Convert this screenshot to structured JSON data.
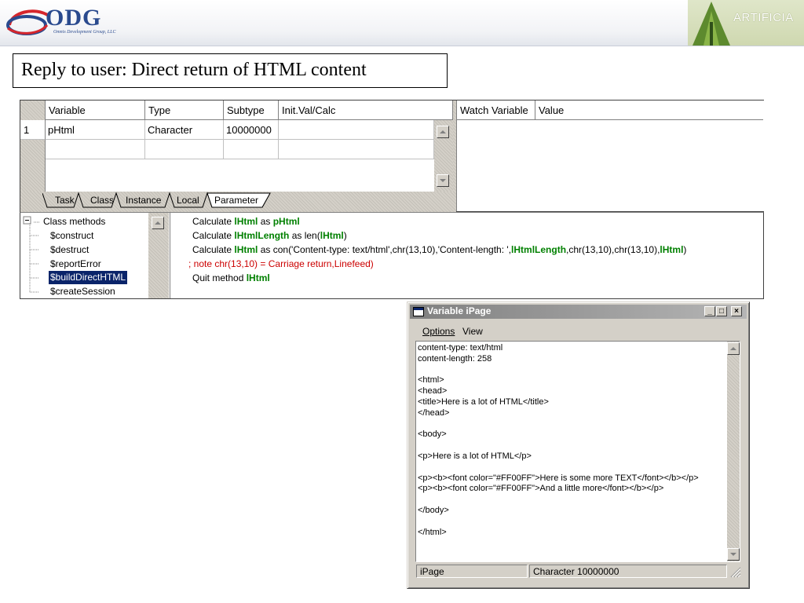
{
  "header": {
    "logo_text": "ODG",
    "logo_subtext": "Omnis Development Group, LLC",
    "right_logo_text": "ARTIFICIA",
    "colors": {
      "logo_blue": "#2a4a8e",
      "logo_red": "#d6262c",
      "artificia_green": "#5d8a2e"
    }
  },
  "slide_title": "Reply to user: Direct return of HTML content",
  "variables_grid": {
    "columns": [
      "Variable",
      "Type",
      "Subtype",
      "Init.Val/Calc"
    ],
    "rows": [
      {
        "num": "1",
        "variable": "pHtml",
        "type": "Character",
        "subtype": "10000000",
        "init": ""
      }
    ],
    "tabs": [
      "Task",
      "Class",
      "Instance",
      "Local",
      "Parameter"
    ],
    "active_tab": "Parameter",
    "watch_columns": [
      "Watch Variable",
      "Value"
    ]
  },
  "method_tree": {
    "root": "Class methods",
    "root_expander": "⊟",
    "items": [
      "$construct",
      "$destruct",
      "$reportError",
      "$buildDirectHTML",
      "$createSession"
    ],
    "selected": "$buildDirectHTML"
  },
  "code_lines": [
    [
      {
        "t": "Calculate ",
        "c": "kw"
      },
      {
        "t": "lHtml",
        "c": "var"
      },
      {
        "t": " as ",
        "c": "kw"
      },
      {
        "t": "pHtml",
        "c": "var"
      }
    ],
    [
      {
        "t": "Calculate ",
        "c": "kw"
      },
      {
        "t": "lHtmlLength",
        "c": "var"
      },
      {
        "t": " as len(",
        "c": "kw"
      },
      {
        "t": "lHtml",
        "c": "var"
      },
      {
        "t": ")",
        "c": "kw"
      }
    ],
    [
      {
        "t": "Calculate ",
        "c": "kw"
      },
      {
        "t": "lHtml",
        "c": "var"
      },
      {
        "t": " as con('Content-type: text/html',chr(13,10),'Content-length: ',",
        "c": "str"
      },
      {
        "t": "lHtmlLength",
        "c": "var"
      },
      {
        "t": ",chr(13,10),chr(13,10),",
        "c": "str"
      },
      {
        "t": "lHtml",
        "c": "var"
      },
      {
        "t": ")",
        "c": "str"
      }
    ],
    [
      {
        "t": ";  note chr(13,10) = Carriage return,Linefeed)",
        "c": "cmt"
      }
    ],
    [
      {
        "t": "Quit method ",
        "c": "kw"
      },
      {
        "t": "lHtml",
        "c": "var"
      }
    ]
  ],
  "ipage_window": {
    "title": "Variable iPage",
    "menu": [
      "Options",
      "View"
    ],
    "content_lines": [
      "content-type: text/html",
      "content-length: 258",
      "",
      "<html>",
      "<head>",
      "<title>Here is a lot of HTML</title>",
      "</head>",
      "",
      "<body>",
      "",
      "<p>Here is a lot of HTML</p>",
      "",
      "<p><b><font color=\"#FF00FF\">Here is some more TEXT</font></b></p>",
      "<p><b><font color=\"#FF00FF\">And a little more</font></b></p>",
      "",
      "</body>",
      "",
      "</html>"
    ],
    "status_name": "iPage",
    "status_type": "Character   10000000",
    "buttons": {
      "minimize": "_",
      "maximize": "□",
      "close": "×"
    }
  }
}
